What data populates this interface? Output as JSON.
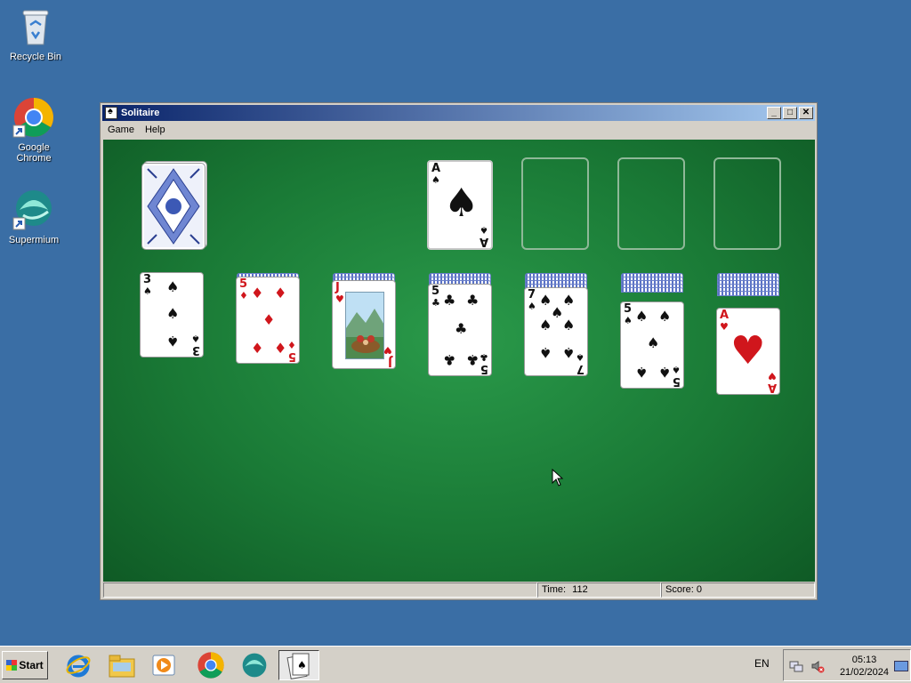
{
  "desktop": {
    "icons": [
      {
        "label": "Recycle Bin",
        "icon": "recycle-bin-icon"
      },
      {
        "label": "Google Chrome",
        "icon": "chrome-icon"
      },
      {
        "label": "Supermium",
        "icon": "supermium-icon"
      }
    ]
  },
  "window": {
    "title": "Solitaire",
    "menu": [
      "Game",
      "Help"
    ],
    "status": {
      "time_label": "Time:",
      "time": "112",
      "score_label": "Score:",
      "score": "0"
    },
    "controls": {
      "minimize": "_",
      "maximize": "□",
      "close": "✕"
    }
  },
  "game": {
    "stock": {
      "face": "down"
    },
    "foundations": [
      {
        "rank": "A",
        "suit": "♠",
        "color": "black"
      },
      null,
      null,
      null
    ],
    "tableau": [
      {
        "hidden": 0,
        "top": {
          "rank": "3",
          "suit": "♠",
          "color": "black"
        }
      },
      {
        "hidden": 1,
        "top": {
          "rank": "5",
          "suit": "♦",
          "color": "red"
        }
      },
      {
        "hidden": 2,
        "top": {
          "rank": "J",
          "suit": "♥",
          "color": "red",
          "face_art": "jack-of-hearts-art"
        }
      },
      {
        "hidden": 3,
        "top": {
          "rank": "5",
          "suit": "♣",
          "color": "black"
        }
      },
      {
        "hidden": 4,
        "top": {
          "rank": "7",
          "suit": "♠",
          "color": "black"
        }
      },
      {
        "hidden": 5,
        "top": {
          "rank": "5",
          "suit": "♠",
          "color": "black"
        }
      },
      {
        "hidden": 6,
        "top": {
          "rank": "A",
          "suit": "♥",
          "color": "red"
        }
      }
    ]
  },
  "taskbar": {
    "start_label": "Start",
    "apps": [
      "internet-explorer-icon",
      "file-explorer-icon",
      "media-player-icon",
      "chrome-icon",
      "supermium-icon",
      "solitaire-icon"
    ],
    "language": "EN",
    "time": "05:13",
    "date": "21/02/2024"
  },
  "colors": {
    "desktop": "#3a6ea5",
    "felt": "#1a7a36",
    "red_suit": "#d0161c"
  }
}
